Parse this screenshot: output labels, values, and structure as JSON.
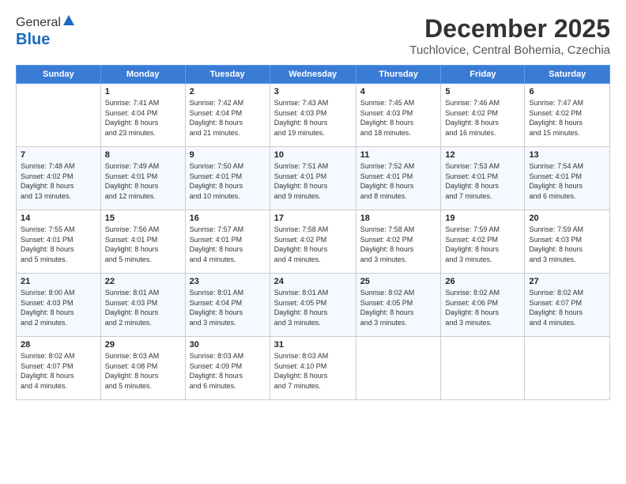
{
  "logo": {
    "general": "General",
    "blue": "Blue"
  },
  "title": {
    "month": "December 2025",
    "location": "Tuchlovice, Central Bohemia, Czechia"
  },
  "calendar": {
    "headers": [
      "Sunday",
      "Monday",
      "Tuesday",
      "Wednesday",
      "Thursday",
      "Friday",
      "Saturday"
    ],
    "weeks": [
      [
        {
          "day": "",
          "info": ""
        },
        {
          "day": "1",
          "info": "Sunrise: 7:41 AM\nSunset: 4:04 PM\nDaylight: 8 hours\nand 23 minutes."
        },
        {
          "day": "2",
          "info": "Sunrise: 7:42 AM\nSunset: 4:04 PM\nDaylight: 8 hours\nand 21 minutes."
        },
        {
          "day": "3",
          "info": "Sunrise: 7:43 AM\nSunset: 4:03 PM\nDaylight: 8 hours\nand 19 minutes."
        },
        {
          "day": "4",
          "info": "Sunrise: 7:45 AM\nSunset: 4:03 PM\nDaylight: 8 hours\nand 18 minutes."
        },
        {
          "day": "5",
          "info": "Sunrise: 7:46 AM\nSunset: 4:02 PM\nDaylight: 8 hours\nand 16 minutes."
        },
        {
          "day": "6",
          "info": "Sunrise: 7:47 AM\nSunset: 4:02 PM\nDaylight: 8 hours\nand 15 minutes."
        }
      ],
      [
        {
          "day": "7",
          "info": "Sunrise: 7:48 AM\nSunset: 4:02 PM\nDaylight: 8 hours\nand 13 minutes."
        },
        {
          "day": "8",
          "info": "Sunrise: 7:49 AM\nSunset: 4:01 PM\nDaylight: 8 hours\nand 12 minutes."
        },
        {
          "day": "9",
          "info": "Sunrise: 7:50 AM\nSunset: 4:01 PM\nDaylight: 8 hours\nand 10 minutes."
        },
        {
          "day": "10",
          "info": "Sunrise: 7:51 AM\nSunset: 4:01 PM\nDaylight: 8 hours\nand 9 minutes."
        },
        {
          "day": "11",
          "info": "Sunrise: 7:52 AM\nSunset: 4:01 PM\nDaylight: 8 hours\nand 8 minutes."
        },
        {
          "day": "12",
          "info": "Sunrise: 7:53 AM\nSunset: 4:01 PM\nDaylight: 8 hours\nand 7 minutes."
        },
        {
          "day": "13",
          "info": "Sunrise: 7:54 AM\nSunset: 4:01 PM\nDaylight: 8 hours\nand 6 minutes."
        }
      ],
      [
        {
          "day": "14",
          "info": "Sunrise: 7:55 AM\nSunset: 4:01 PM\nDaylight: 8 hours\nand 5 minutes."
        },
        {
          "day": "15",
          "info": "Sunrise: 7:56 AM\nSunset: 4:01 PM\nDaylight: 8 hours\nand 5 minutes."
        },
        {
          "day": "16",
          "info": "Sunrise: 7:57 AM\nSunset: 4:01 PM\nDaylight: 8 hours\nand 4 minutes."
        },
        {
          "day": "17",
          "info": "Sunrise: 7:58 AM\nSunset: 4:02 PM\nDaylight: 8 hours\nand 4 minutes."
        },
        {
          "day": "18",
          "info": "Sunrise: 7:58 AM\nSunset: 4:02 PM\nDaylight: 8 hours\nand 3 minutes."
        },
        {
          "day": "19",
          "info": "Sunrise: 7:59 AM\nSunset: 4:02 PM\nDaylight: 8 hours\nand 3 minutes."
        },
        {
          "day": "20",
          "info": "Sunrise: 7:59 AM\nSunset: 4:03 PM\nDaylight: 8 hours\nand 3 minutes."
        }
      ],
      [
        {
          "day": "21",
          "info": "Sunrise: 8:00 AM\nSunset: 4:03 PM\nDaylight: 8 hours\nand 2 minutes."
        },
        {
          "day": "22",
          "info": "Sunrise: 8:01 AM\nSunset: 4:03 PM\nDaylight: 8 hours\nand 2 minutes."
        },
        {
          "day": "23",
          "info": "Sunrise: 8:01 AM\nSunset: 4:04 PM\nDaylight: 8 hours\nand 3 minutes."
        },
        {
          "day": "24",
          "info": "Sunrise: 8:01 AM\nSunset: 4:05 PM\nDaylight: 8 hours\nand 3 minutes."
        },
        {
          "day": "25",
          "info": "Sunrise: 8:02 AM\nSunset: 4:05 PM\nDaylight: 8 hours\nand 3 minutes."
        },
        {
          "day": "26",
          "info": "Sunrise: 8:02 AM\nSunset: 4:06 PM\nDaylight: 8 hours\nand 3 minutes."
        },
        {
          "day": "27",
          "info": "Sunrise: 8:02 AM\nSunset: 4:07 PM\nDaylight: 8 hours\nand 4 minutes."
        }
      ],
      [
        {
          "day": "28",
          "info": "Sunrise: 8:02 AM\nSunset: 4:07 PM\nDaylight: 8 hours\nand 4 minutes."
        },
        {
          "day": "29",
          "info": "Sunrise: 8:03 AM\nSunset: 4:08 PM\nDaylight: 8 hours\nand 5 minutes."
        },
        {
          "day": "30",
          "info": "Sunrise: 8:03 AM\nSunset: 4:09 PM\nDaylight: 8 hours\nand 6 minutes."
        },
        {
          "day": "31",
          "info": "Sunrise: 8:03 AM\nSunset: 4:10 PM\nDaylight: 8 hours\nand 7 minutes."
        },
        {
          "day": "",
          "info": ""
        },
        {
          "day": "",
          "info": ""
        },
        {
          "day": "",
          "info": ""
        }
      ]
    ]
  }
}
